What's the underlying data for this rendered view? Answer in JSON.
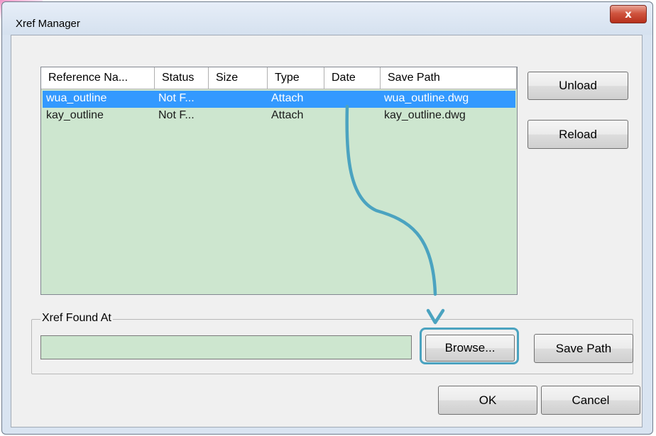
{
  "window": {
    "title": "Xref Manager",
    "close_label": "x"
  },
  "listview": {
    "columns": [
      "Reference Na...",
      "Status",
      "Size",
      "Type",
      "Date",
      "Save Path"
    ],
    "rows": [
      {
        "name": "wua_outline",
        "status": "Not F...",
        "size": "",
        "type": "Attach",
        "date": "",
        "save_path": "wua_outline.dwg",
        "selected": true
      },
      {
        "name": "kay_outline",
        "status": "Not F...",
        "size": "",
        "type": "Attach",
        "date": "",
        "save_path": "kay_outline.dwg",
        "selected": false
      }
    ]
  },
  "buttons": {
    "unload": "Unload",
    "reload": "Reload",
    "browse": "Browse...",
    "save_path": "Save Path",
    "ok": "OK",
    "cancel": "Cancel"
  },
  "found_at": {
    "label": "Xref Found At",
    "value": ""
  },
  "colors": {
    "list_background": "#cde6cf",
    "selection": "#3399ff",
    "callout": "#4ba3c0"
  },
  "icons": {
    "close": "close-icon",
    "annotation": "curved-arrow-annotation"
  }
}
